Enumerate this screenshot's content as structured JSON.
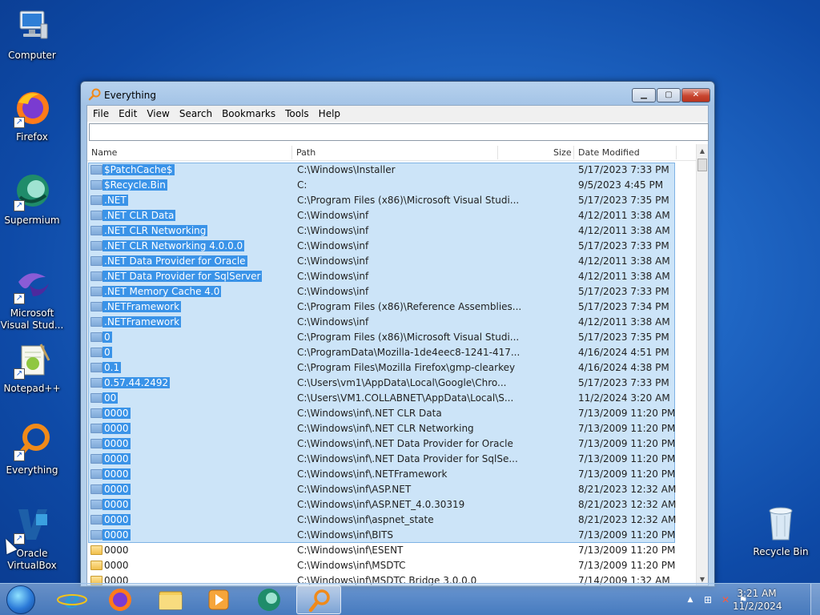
{
  "desktop": {
    "icons": [
      {
        "label": "Computer"
      },
      {
        "label": "Firefox"
      },
      {
        "label": "Supermium"
      },
      {
        "label": "Microsoft Visual Stud..."
      },
      {
        "label": "Notepad++"
      },
      {
        "label": "Everything"
      },
      {
        "label": "Oracle VirtualBox"
      },
      {
        "label": "Recycle Bin"
      }
    ]
  },
  "window": {
    "title": "Everything",
    "menu": [
      "File",
      "Edit",
      "View",
      "Search",
      "Bookmarks",
      "Tools",
      "Help"
    ],
    "search_value": "",
    "columns": {
      "name": "Name",
      "path": "Path",
      "size": "Size",
      "date": "Date Modified"
    },
    "rows": [
      {
        "name": "$PatchCache$",
        "path": "C:\\Windows\\Installer",
        "date": "5/17/2023 7:33 PM",
        "selected": true
      },
      {
        "name": "$Recycle.Bin",
        "path": "C:",
        "date": "9/5/2023 4:45 PM",
        "selected": true
      },
      {
        "name": ".NET",
        "path": "C:\\Program Files (x86)\\Microsoft Visual Studi...",
        "date": "5/17/2023 7:35 PM",
        "selected": true
      },
      {
        "name": ".NET CLR Data",
        "path": "C:\\Windows\\inf",
        "date": "4/12/2011 3:38 AM",
        "selected": true
      },
      {
        "name": ".NET CLR Networking",
        "path": "C:\\Windows\\inf",
        "date": "4/12/2011 3:38 AM",
        "selected": true
      },
      {
        "name": ".NET CLR Networking 4.0.0.0",
        "path": "C:\\Windows\\inf",
        "date": "5/17/2023 7:33 PM",
        "selected": true
      },
      {
        "name": ".NET Data Provider for Oracle",
        "path": "C:\\Windows\\inf",
        "date": "4/12/2011 3:38 AM",
        "selected": true
      },
      {
        "name": ".NET Data Provider for SqlServer",
        "path": "C:\\Windows\\inf",
        "date": "4/12/2011 3:38 AM",
        "selected": true
      },
      {
        "name": ".NET Memory Cache 4.0",
        "path": "C:\\Windows\\inf",
        "date": "5/17/2023 7:33 PM",
        "selected": true
      },
      {
        "name": ".NETFramework",
        "path": "C:\\Program Files (x86)\\Reference Assemblies...",
        "date": "5/17/2023 7:34 PM",
        "selected": true
      },
      {
        "name": ".NETFramework",
        "path": "C:\\Windows\\inf",
        "date": "4/12/2011 3:38 AM",
        "selected": true
      },
      {
        "name": "0",
        "path": "C:\\Program Files (x86)\\Microsoft Visual Studi...",
        "date": "5/17/2023 7:35 PM",
        "selected": true
      },
      {
        "name": "0",
        "path": "C:\\ProgramData\\Mozilla-1de4eec8-1241-417...",
        "date": "4/16/2024 4:51 PM",
        "selected": true
      },
      {
        "name": "0.1",
        "path": "C:\\Program Files\\Mozilla Firefox\\gmp-clearkey",
        "date": "4/16/2024 4:38 PM",
        "selected": true
      },
      {
        "name": "0.57.44.2492",
        "path": "C:\\Users\\vm1\\AppData\\Local\\Google\\Chro...",
        "date": "5/17/2023 7:33 PM",
        "selected": true
      },
      {
        "name": "00",
        "path": "C:\\Users\\VM1.COLLABNET\\AppData\\Local\\S...",
        "date": "11/2/2024 3:20 AM",
        "selected": true
      },
      {
        "name": "0000",
        "path": "C:\\Windows\\inf\\.NET CLR Data",
        "date": "7/13/2009 11:20 PM",
        "selected": true
      },
      {
        "name": "0000",
        "path": "C:\\Windows\\inf\\.NET CLR Networking",
        "date": "7/13/2009 11:20 PM",
        "selected": true
      },
      {
        "name": "0000",
        "path": "C:\\Windows\\inf\\.NET Data Provider for Oracle",
        "date": "7/13/2009 11:20 PM",
        "selected": true
      },
      {
        "name": "0000",
        "path": "C:\\Windows\\inf\\.NET Data Provider for SqlSe...",
        "date": "7/13/2009 11:20 PM",
        "selected": true
      },
      {
        "name": "0000",
        "path": "C:\\Windows\\inf\\.NETFramework",
        "date": "7/13/2009 11:20 PM",
        "selected": true
      },
      {
        "name": "0000",
        "path": "C:\\Windows\\inf\\ASP.NET",
        "date": "8/21/2023 12:32 AM",
        "selected": true
      },
      {
        "name": "0000",
        "path": "C:\\Windows\\inf\\ASP.NET_4.0.30319",
        "date": "8/21/2023 12:32 AM",
        "selected": true
      },
      {
        "name": "0000",
        "path": "C:\\Windows\\inf\\aspnet_state",
        "date": "8/21/2023 12:32 AM",
        "selected": true
      },
      {
        "name": "0000",
        "path": "C:\\Windows\\inf\\BITS",
        "date": "7/13/2009 11:20 PM",
        "selected": true
      },
      {
        "name": "0000",
        "path": "C:\\Windows\\inf\\ESENT",
        "date": "7/13/2009 11:20 PM",
        "selected": false
      },
      {
        "name": "0000",
        "path": "C:\\Windows\\inf\\MSDTC",
        "date": "7/13/2009 11:20 PM",
        "selected": false
      },
      {
        "name": "0000",
        "path": "C:\\Windows\\inf\\MSDTC Bridge 3.0.0.0",
        "date": "7/14/2009 1:32 AM",
        "selected": false
      }
    ]
  },
  "taskbar": {
    "apps": [
      "internet-explorer-icon",
      "firefox-icon",
      "file-explorer-icon",
      "media-player-icon",
      "supermium-icon",
      "everything-icon"
    ],
    "clock_time": "3:21 AM",
    "clock_date": "11/2/2024"
  },
  "colors": {
    "selection_fill": "#cce4f8",
    "selection_name": "#3a93e8",
    "desktop": "#1f66c4"
  }
}
